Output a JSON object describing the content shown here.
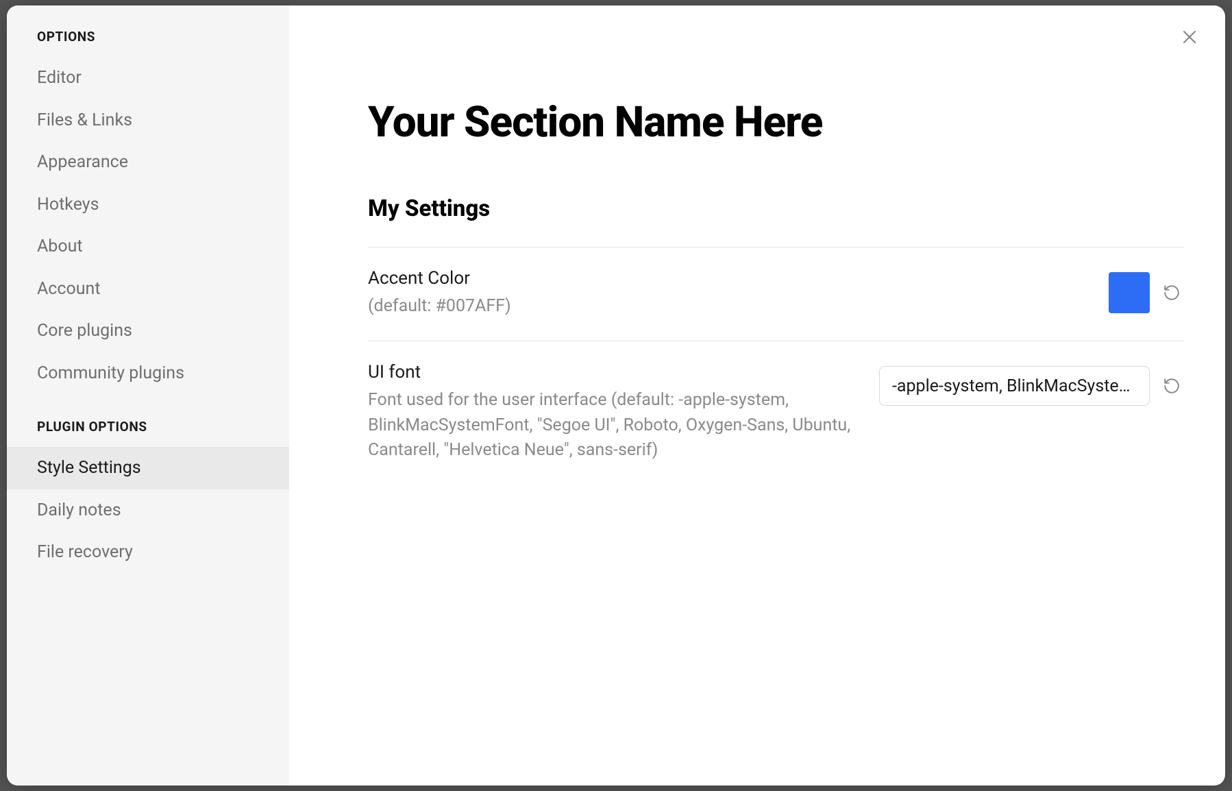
{
  "sidebar": {
    "section1_header": "OPTIONS",
    "section1_items": [
      {
        "label": "Editor"
      },
      {
        "label": "Files & Links"
      },
      {
        "label": "Appearance"
      },
      {
        "label": "Hotkeys"
      },
      {
        "label": "About"
      },
      {
        "label": "Account"
      },
      {
        "label": "Core plugins"
      },
      {
        "label": "Community plugins"
      }
    ],
    "section2_header": "PLUGIN OPTIONS",
    "section2_items": [
      {
        "label": "Style Settings",
        "active": true
      },
      {
        "label": "Daily notes"
      },
      {
        "label": "File recovery"
      }
    ]
  },
  "content": {
    "page_title": "Your Section Name Here",
    "section_title": "My Settings",
    "settings": [
      {
        "name": "Accent Color",
        "desc": "(default: #007AFF)",
        "color_value": "#2d6df6"
      },
      {
        "name": "UI font",
        "desc": "Font used for the user interface (default: -apple-system, BlinkMacSystemFont, \"Segoe UI\", Roboto, Oxygen-Sans, Ubuntu, Cantarell, \"Helvetica Neue\", sans-serif)",
        "text_value": "-apple-system, BlinkMacSystemFont, \"Segoe UI\", Roboto, Oxygen-Sans, Ubuntu, Cantarell, \"Helvetica Neue\", sans-serif"
      }
    ]
  }
}
